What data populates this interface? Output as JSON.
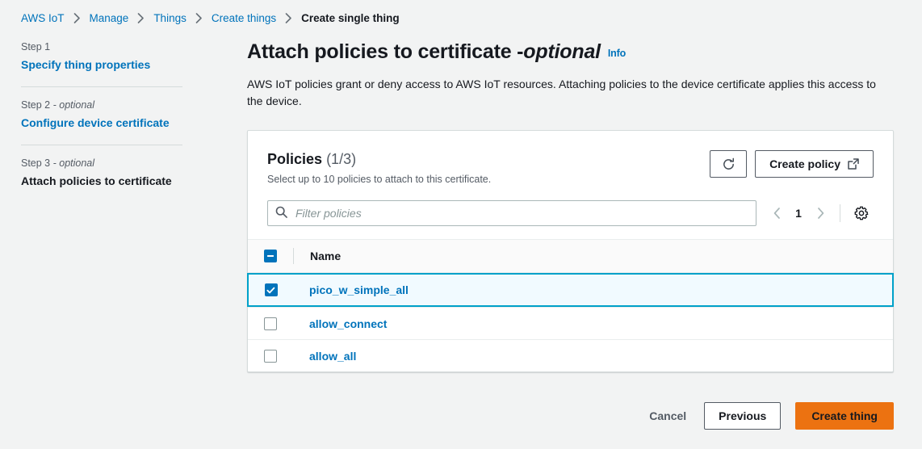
{
  "breadcrumb": {
    "items": [
      {
        "label": "AWS IoT",
        "current": false
      },
      {
        "label": "Manage",
        "current": false
      },
      {
        "label": "Things",
        "current": false
      },
      {
        "label": "Create things",
        "current": false
      },
      {
        "label": "Create single thing",
        "current": true
      }
    ]
  },
  "sidebar": {
    "steps": [
      {
        "step_label": "Step 1",
        "optional_suffix": "",
        "title": "Specify thing properties",
        "current": false
      },
      {
        "step_label": "Step 2",
        "optional_suffix": " - optional",
        "title": "Configure device certificate",
        "current": false
      },
      {
        "step_label": "Step 3",
        "optional_suffix": " - optional",
        "title": "Attach policies to certificate",
        "current": true
      }
    ]
  },
  "page": {
    "title_main": "Attach policies to certificate - ",
    "title_optional": "optional",
    "info_label": "Info",
    "description": "AWS IoT policies grant or deny access to AWS IoT resources. Attaching policies to the device certificate applies this access to the device."
  },
  "card": {
    "heading": "Policies",
    "count": "(1/3)",
    "subheading": "Select up to 10 policies to attach to this certificate.",
    "refresh_label": "refresh-icon",
    "create_policy_label": "Create policy"
  },
  "filter": {
    "placeholder": "Filter policies",
    "value": "",
    "search_icon": "search-icon"
  },
  "pagination": {
    "prev_icon": "chevron-left-icon",
    "page": "1",
    "next_icon": "chevron-right-icon",
    "settings_icon": "gear-icon"
  },
  "table": {
    "columns": [
      "Name"
    ],
    "select_all_state": "indeterminate",
    "rows": [
      {
        "name": "pico_w_simple_all",
        "selected": true
      },
      {
        "name": "allow_connect",
        "selected": false
      },
      {
        "name": "allow_all",
        "selected": false
      }
    ]
  },
  "footer": {
    "cancel_label": "Cancel",
    "previous_label": "Previous",
    "create_label": "Create thing"
  },
  "colors": {
    "link": "#0073bb",
    "primary_button": "#ec7211",
    "selected_row_bg": "#f1faff",
    "selected_row_border": "#00a1c9",
    "page_bg": "#f2f3f3"
  }
}
